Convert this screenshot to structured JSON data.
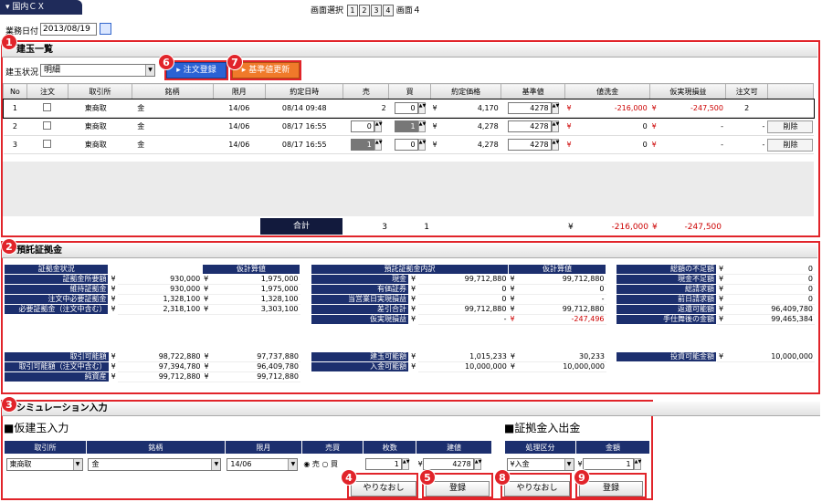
{
  "top": {
    "tab_label": "国内ＣＸ",
    "screen_select_label": "画面選択",
    "screens": [
      "1",
      "2",
      "3",
      "4"
    ],
    "screen_current": "画面４",
    "date_label": "業務日付",
    "date_value": "2013/08/19"
  },
  "badges": [
    "1",
    "2",
    "3",
    "4",
    "5",
    "6",
    "7",
    "8",
    "9"
  ],
  "positions": {
    "title": "建玉一覧",
    "status_label": "建玉状況",
    "status_value": "明細",
    "order_button": "注文登録",
    "update_button": "基準値更新",
    "columns": [
      "No",
      "注文",
      "取引所",
      "銘柄",
      "限月",
      "約定日時",
      "売",
      "買",
      "約定価格",
      "基準値",
      "値洗金",
      "仮実現損益",
      "注文可"
    ],
    "rows": [
      {
        "no": "1",
        "exchange": "東商取",
        "product": "金",
        "month": "14/06",
        "datetime": "08/14 09:48",
        "sell": "2",
        "buy": "0",
        "price_yen": "¥",
        "price": "4,170",
        "base_yen": "¥",
        "base": "4278",
        "mtm_yen": "¥",
        "mtm": "-216,000",
        "pnl_yen": "¥",
        "pnl": "-247,500",
        "orderable": "2",
        "action": ""
      },
      {
        "no": "2",
        "exchange": "東商取",
        "product": "金",
        "month": "14/06",
        "datetime": "08/17 16:55",
        "sell": "0",
        "buy": "1",
        "price_yen": "¥",
        "price": "4,278",
        "base_yen": "¥",
        "base": "4278",
        "mtm_yen": "¥",
        "mtm": "0",
        "pnl_yen": "¥",
        "pnl": "-",
        "orderable": "-",
        "action": "削除"
      },
      {
        "no": "3",
        "exchange": "東商取",
        "product": "金",
        "month": "14/06",
        "datetime": "08/17 16:55",
        "sell": "1",
        "buy": "0",
        "price_yen": "¥",
        "price": "4,278",
        "base_yen": "¥",
        "base": "4278",
        "mtm_yen": "¥",
        "mtm": "0",
        "pnl_yen": "¥",
        "pnl": "-",
        "orderable": "-",
        "action": "削除"
      }
    ],
    "total_label": "合計",
    "total_sell": "3",
    "total_buy": "1",
    "total_mtm_yen": "¥",
    "total_mtm": "-216,000",
    "total_pnl_yen": "¥",
    "total_pnl": "-247,500"
  },
  "margin": {
    "title": "預託証拠金",
    "status": {
      "headers": [
        "証拠金状況",
        "仮計算値"
      ],
      "rows1": [
        {
          "label": "証拠金所要額",
          "v1": "930,000",
          "v2": "1,975,000"
        },
        {
          "label": "維持証拠金",
          "v1": "930,000",
          "v2": "1,975,000"
        },
        {
          "label": "注文中必要証拠金",
          "v1": "1,328,100",
          "v2": "1,328,100"
        },
        {
          "label": "必要証拠金（注文中含む）",
          "v1": "2,318,100",
          "v2": "3,303,100"
        }
      ],
      "rows2": [
        {
          "label": "取引可能額",
          "v1": "98,722,880",
          "v2": "97,737,880"
        },
        {
          "label": "取引可能額（注文中含む）",
          "v1": "97,394,780",
          "v2": "96,409,780"
        },
        {
          "label": "純資産",
          "v1": "99,712,880",
          "v2": "99,712,880"
        }
      ]
    },
    "deposit": {
      "headers": [
        "預託証拠金内訳",
        "仮計算値"
      ],
      "rows1": [
        {
          "label": "現金",
          "v1": "99,712,880",
          "v2": "99,712,880"
        },
        {
          "label": "有価証券",
          "v1": "0",
          "v2": "0"
        },
        {
          "label": "当営業日実現損益",
          "v1": "0",
          "v2": "-"
        },
        {
          "label": "差引合計",
          "v1": "99,712,880",
          "v2": "99,712,880"
        },
        {
          "label": "仮実現損益",
          "v1": "-",
          "v2": "-247,496"
        }
      ],
      "rows2": [
        {
          "label": "建玉可能額",
          "v1": "1,015,233",
          "v2": "30,233"
        },
        {
          "label": "入金可能額",
          "v1": "10,000,000",
          "v2": "10,000,000"
        }
      ]
    },
    "other": {
      "rows1": [
        {
          "label": "総額の不足額",
          "v": "0"
        },
        {
          "label": "現金不足額",
          "v": "0"
        },
        {
          "label": "総請求額",
          "v": "0"
        },
        {
          "label": "前日請求額",
          "v": "0"
        },
        {
          "label": "返還可能額",
          "v": "96,409,780"
        },
        {
          "label": "手仕舞後の金額",
          "v": "99,465,384"
        }
      ],
      "rows2": [
        {
          "label": "投資可能金額",
          "v": "10,000,000"
        }
      ]
    },
    "yen": "¥"
  },
  "sim": {
    "title": "シミュレーション入力",
    "virtual_title": "■仮建玉入力",
    "virtual_headers": [
      "取引所",
      "銘柄",
      "限月",
      "売買",
      "枚数",
      "建値"
    ],
    "exchange_value": "東商取",
    "product_value": "金",
    "month_value": "14/06",
    "side_sell": "売",
    "side_buy": "買",
    "qty_value": "1",
    "price_yen": "¥",
    "price_value": "4278",
    "reset_button": "やりなおし",
    "register_button": "登録",
    "deposit_title": "■証拠金入出金",
    "deposit_headers": [
      "処理区分",
      "金額"
    ],
    "deposit_type": "¥入金",
    "amount_yen": "¥",
    "amount_value": "1",
    "reset_button2": "やりなおし",
    "register_button2": "登録"
  }
}
